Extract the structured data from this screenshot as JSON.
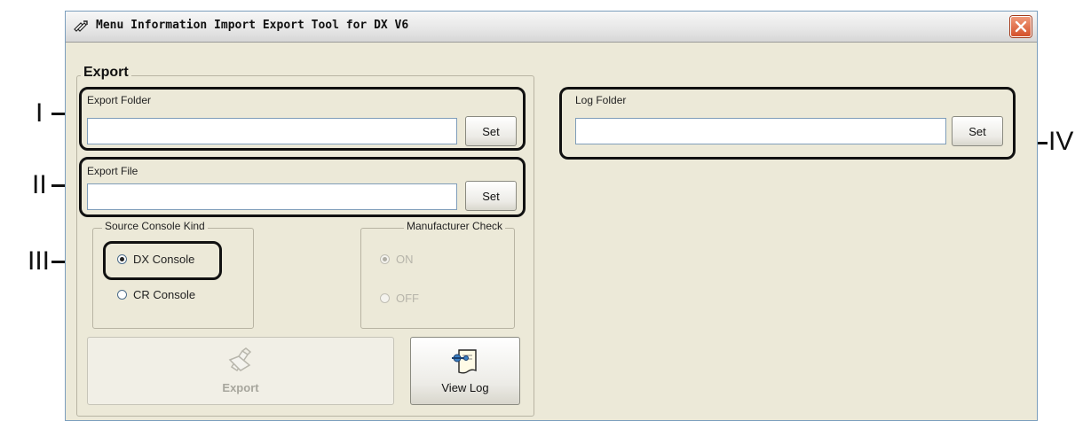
{
  "window": {
    "title": "Menu Information Import Export Tool for DX V6"
  },
  "export_group": {
    "title": "Export",
    "export_folder": {
      "label": "Export Folder",
      "value": "",
      "button": "Set"
    },
    "export_file": {
      "label": "Export File",
      "value": "",
      "button": "Set"
    },
    "source_console_kind": {
      "title": "Source Console Kind",
      "options": [
        {
          "label": "DX Console",
          "checked": true
        },
        {
          "label": "CR Console",
          "checked": false
        }
      ]
    },
    "manufacturer_check": {
      "title": "Manufacturer Check",
      "enabled": false,
      "options": [
        {
          "label": "ON",
          "checked": true
        },
        {
          "label": "OFF",
          "checked": false
        }
      ]
    },
    "export_button": {
      "label": "Export",
      "icon": "export-pen-icon",
      "enabled": false
    },
    "view_log_button": {
      "label": "View Log",
      "icon": "log-document-icon"
    }
  },
  "log_folder": {
    "label": "Log Folder",
    "value": "",
    "button": "Set"
  },
  "callouts": [
    "I",
    "II",
    "III",
    "IV"
  ]
}
